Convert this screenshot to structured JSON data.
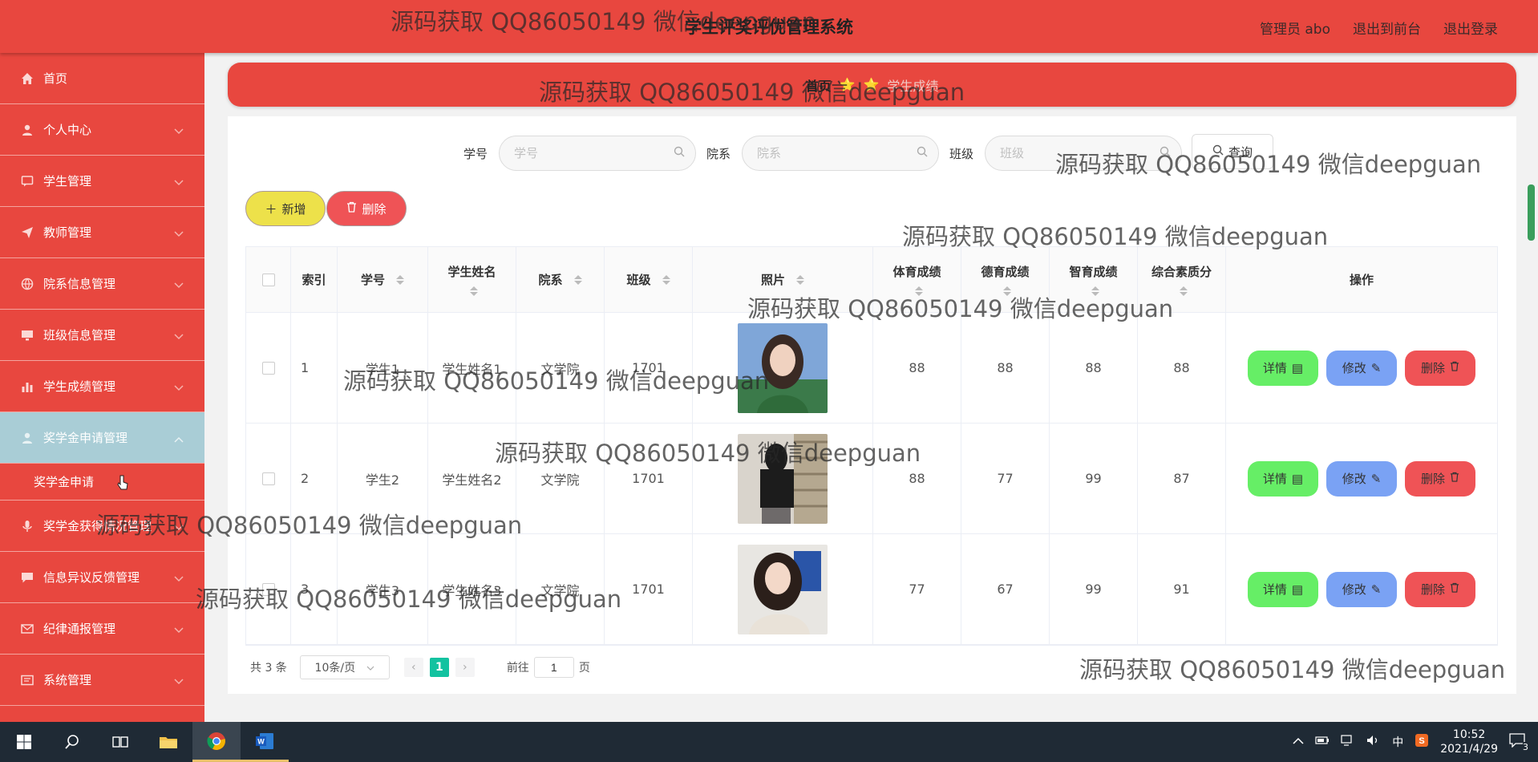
{
  "header": {
    "title": "学生评奖评优管理系统",
    "admin_label": "管理员 abo",
    "front_label": "退出到前台",
    "logout_label": "退出登录"
  },
  "sidebar": {
    "items": [
      {
        "label": "首页",
        "icon": "home-icon"
      },
      {
        "label": "个人中心",
        "icon": "user-icon"
      },
      {
        "label": "学生管理",
        "icon": "chat-icon"
      },
      {
        "label": "教师管理",
        "icon": "send-icon"
      },
      {
        "label": "院系信息管理",
        "icon": "globe-icon"
      },
      {
        "label": "班级信息管理",
        "icon": "monitor-icon"
      },
      {
        "label": "学生成绩管理",
        "icon": "bar-chart-icon"
      },
      {
        "label": "奖学金申请管理",
        "icon": "person-icon"
      },
      {
        "label": "奖学金获得情况管理",
        "icon": "mic-icon"
      },
      {
        "label": "信息异议反馈管理",
        "icon": "message-icon"
      },
      {
        "label": "纪律通报管理",
        "icon": "mail-icon"
      },
      {
        "label": "系统管理",
        "icon": "settings-icon"
      }
    ],
    "sub_item": "奖学金申请"
  },
  "breadcrumb": {
    "home": "首页",
    "current": "学生成绩"
  },
  "search": {
    "sno_label": "学号",
    "sno_placeholder": "学号",
    "dept_label": "院系",
    "dept_placeholder": "院系",
    "class_label": "班级",
    "class_placeholder": "班级",
    "query_label": "查询"
  },
  "actions": {
    "add_label": "新增",
    "delete_label": "删除"
  },
  "table": {
    "headers": {
      "index": "索引",
      "sno": "学号",
      "name": "学生姓名",
      "dept": "院系",
      "class": "班级",
      "photo": "照片",
      "pe": "体育成绩",
      "moral": "德育成绩",
      "intel": "智育成绩",
      "total": "综合素质分",
      "ops": "操作"
    },
    "rows": [
      {
        "index": "1",
        "sno": "学生1",
        "name": "学生姓名1",
        "dept": "文学院",
        "class": "1701",
        "pe": "88",
        "moral": "88",
        "intel": "88",
        "total": "88"
      },
      {
        "index": "2",
        "sno": "学生2",
        "name": "学生姓名2",
        "dept": "文学院",
        "class": "1701",
        "pe": "88",
        "moral": "77",
        "intel": "99",
        "total": "87"
      },
      {
        "index": "3",
        "sno": "学生3",
        "name": "学生姓名3",
        "dept": "文学院",
        "class": "1701",
        "pe": "77",
        "moral": "67",
        "intel": "99",
        "total": "91"
      }
    ],
    "op_detail": "详情",
    "op_edit": "修改",
    "op_delete": "删除"
  },
  "pager": {
    "total": "共 3 条",
    "page_size": "10条/页",
    "current_page": "1",
    "goto_prefix": "前往",
    "goto_value": "1",
    "goto_suffix": "页"
  },
  "watermark": "源码获取 QQ86050149 微信deepguan",
  "taskbar": {
    "time": "10:52",
    "date": "2021/4/29",
    "ime": "中",
    "notif_count": "3"
  },
  "colors": {
    "primary_red": "#e8473f",
    "active_menu": "#a9cdd6",
    "add_yellow": "#ede14a",
    "detail_green": "#66ee66",
    "edit_blue": "#7aa2f4",
    "pager_teal": "#13c2a0"
  }
}
